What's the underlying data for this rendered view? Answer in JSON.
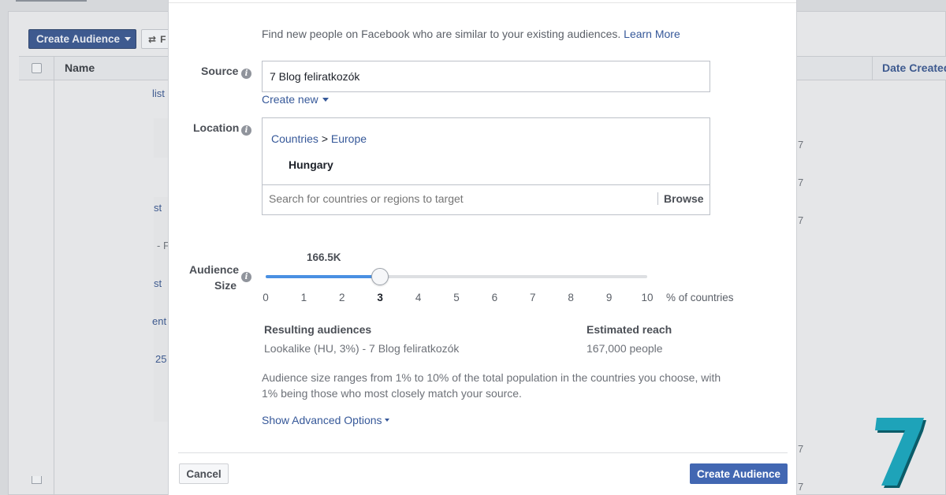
{
  "background": {
    "create_audience_label": "Create Audience",
    "filter_label": "F",
    "column_name": "Name",
    "column_date_created": "Date Created",
    "row_fragments": [
      "list",
      "st",
      "- F",
      "st",
      "ent",
      "25"
    ],
    "right_fragments": [
      "7",
      "7",
      "7",
      "7",
      "7"
    ]
  },
  "modal": {
    "intro_text": "Find new people on Facebook who are similar to your existing audiences.",
    "learn_more": "Learn More",
    "source": {
      "label": "Source",
      "value": "7 Blog feliratkozók",
      "create_new": "Create new"
    },
    "location": {
      "label": "Location",
      "breadcrumb_countries": "Countries",
      "breadcrumb_separator": ">",
      "breadcrumb_region": "Europe",
      "selected_country": "Hungary",
      "search_placeholder": "Search for countries or regions to target",
      "browse_label": "Browse"
    },
    "audience_size": {
      "label_line1": "Audience",
      "label_line2": "Size",
      "value_display": "166.5K",
      "slider_value": 3,
      "slider_max": 10,
      "ticks": [
        "0",
        "1",
        "2",
        "3",
        "4",
        "5",
        "6",
        "7",
        "8",
        "9",
        "10"
      ],
      "unit_label": "% of countries"
    },
    "results": {
      "resulting_head": "Resulting audiences",
      "resulting_value": "Lookalike (HU, 3%) - 7 Blog feliratkozók",
      "reach_head": "Estimated reach",
      "reach_value": "167,000 people"
    },
    "size_note": "Audience size ranges from 1% to 10% of the total population in the countries you choose, with 1% being those who most closely match your source.",
    "advanced_options": "Show Advanced Options",
    "cancel_label": "Cancel",
    "create_label": "Create Audience"
  },
  "brand": {
    "logo_text": "7",
    "color": "#1ea3b9"
  },
  "colors": {
    "link": "#365899",
    "primary_button": "#4267b2",
    "slider_fill": "#4a90e2"
  }
}
